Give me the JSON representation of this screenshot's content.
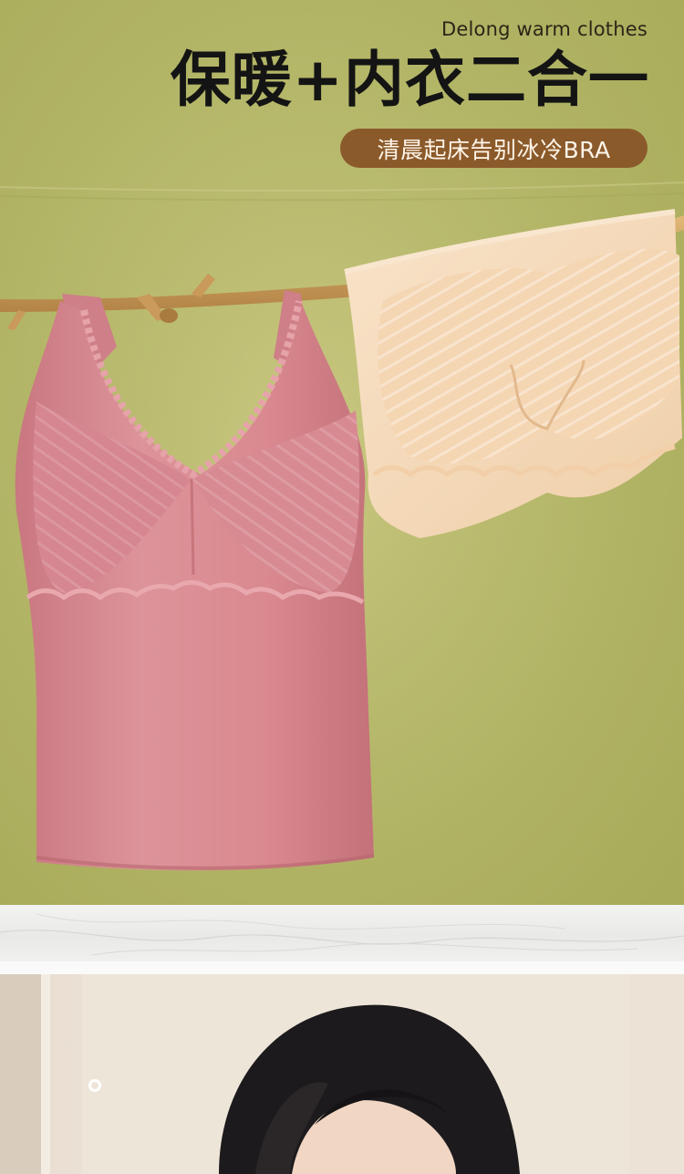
{
  "header": {
    "brand_en": "Delong warm clothes",
    "headline": "保暖+内衣二合一",
    "tagline": "清晨起床告别冰冷BRA"
  },
  "colors": {
    "hero_background": "#b6b86a",
    "pill_background": "#8b5a2b",
    "pink_garment": "#d98c93",
    "cream_garment": "#f6dcbf",
    "branch": "#cfa363"
  },
  "icons": {
    "photo_marker": "ring-icon"
  }
}
